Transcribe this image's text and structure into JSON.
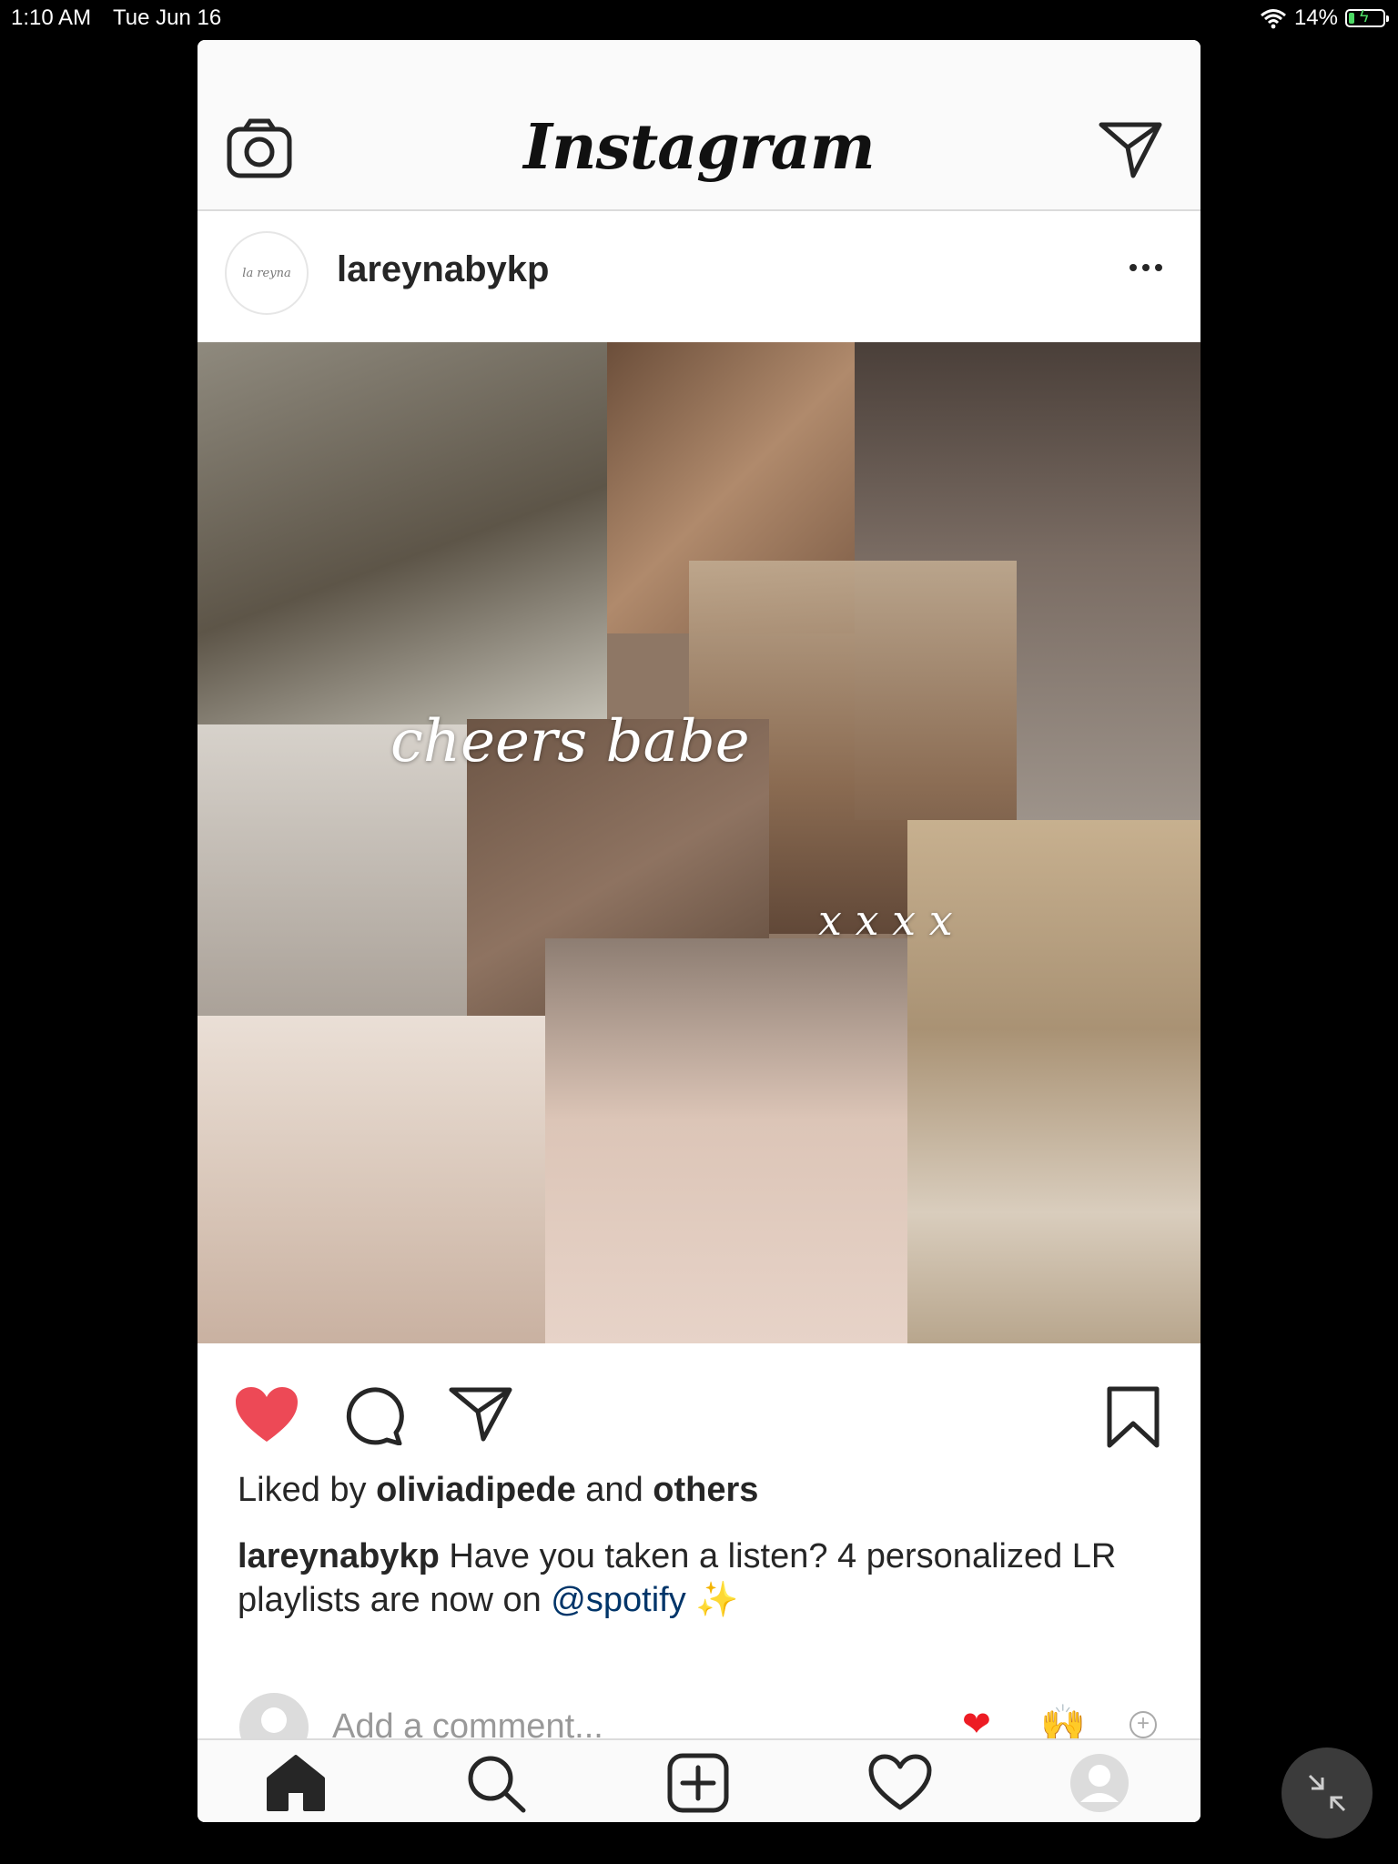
{
  "status_bar": {
    "time": "1:10 AM",
    "date": "Tue Jun 16",
    "battery": "14%"
  },
  "app": {
    "logo": "Instagram"
  },
  "post": {
    "username": "lareynabykp",
    "avatar_text": "la reyna",
    "image_text": {
      "headline": "cheers babe",
      "kisses": "x x x x"
    },
    "liked_by_prefix": "Liked by",
    "liked_by_user": "oliviadipede",
    "liked_by_and": "and",
    "liked_by_others": "others",
    "caption_user": "lareynabykp",
    "caption_text": "Have you taken a listen? 4 personalized LR playlists are now on",
    "caption_mention": "@spotify",
    "caption_emoji": "✨",
    "comment_placeholder": "Add a comment...",
    "quick_reactions": [
      "❤",
      "🙌"
    ]
  },
  "icons": {
    "top": [
      "camera-icon",
      "direct-message-icon"
    ],
    "actions": [
      "heart-icon",
      "comment-icon",
      "share-icon",
      "bookmark-icon"
    ],
    "tabs": [
      "home-icon",
      "search-icon",
      "new-post-icon",
      "activity-heart-icon",
      "profile-icon"
    ]
  },
  "colors": {
    "like_red": "#ed4956",
    "mention_blue": "#003569",
    "border": "#dbdbdb"
  }
}
